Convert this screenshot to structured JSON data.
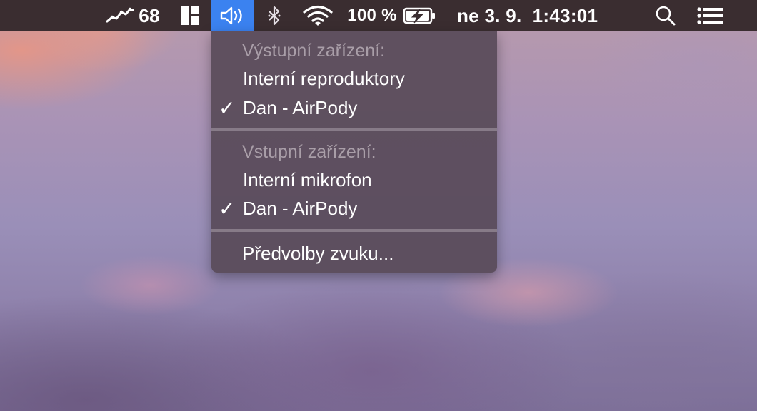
{
  "menubar": {
    "activity_icon": "activity-graph-icon",
    "activity_value": "68",
    "window_manager_icon": "window-layout-icon",
    "volume_icon": "speaker-volume-icon",
    "bluetooth_icon": "bluetooth-icon",
    "wifi_icon": "wifi-icon",
    "battery_percent": "100 %",
    "battery_icon": "battery-charging-icon",
    "datetime": "ne 3. 9.  1:43:01",
    "spotlight_icon": "search-icon",
    "notification_icon": "notification-center-icon",
    "active_color": "#3b82f0",
    "bar_color": "#3a2d30"
  },
  "sound_menu": {
    "output_header": "Výstupní zařízení:",
    "outputs": [
      {
        "label": "Interní reproduktory",
        "checked": false
      },
      {
        "label": "Dan - AirPody",
        "checked": true
      }
    ],
    "input_header": "Vstupní zařízení:",
    "inputs": [
      {
        "label": "Interní mikrofon",
        "checked": false
      },
      {
        "label": "Dan - AirPody",
        "checked": true
      }
    ],
    "preferences": "Předvolby zvuku...",
    "checkmark": "✓"
  }
}
